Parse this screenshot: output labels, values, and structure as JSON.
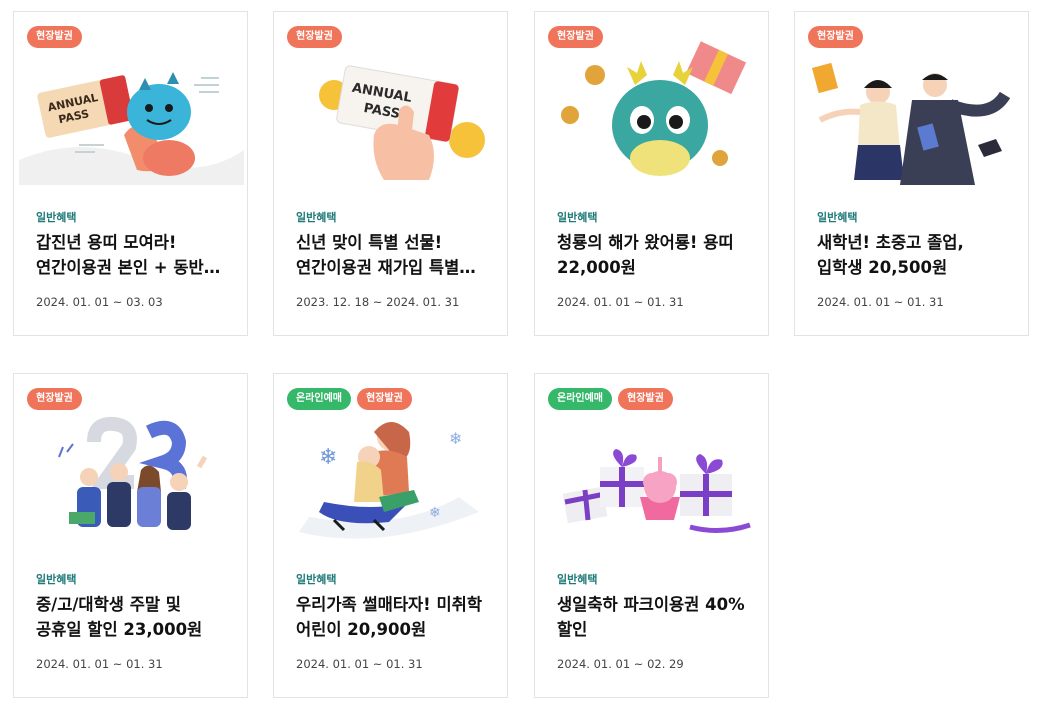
{
  "cards": [
    {
      "badges": [
        "현장발권"
      ],
      "illustration": "annual-pass-dragon",
      "category": "일반혜택",
      "title": "갑진년 용띠 모여라! 연간이용권 본인 + 동반자 할인",
      "date": "2024. 01. 01 ~ 03. 03"
    },
    {
      "badges": [
        "현장발권"
      ],
      "illustration": "annual-pass-ticket-hand",
      "category": "일반혜택",
      "title": "신년 맞이 특별 선물! 연간이용권 재가입 특별 할인",
      "date": "2023. 12. 18 ~ 2024. 01. 31"
    },
    {
      "badges": [
        "현장발권"
      ],
      "illustration": "blue-dragon",
      "category": "일반혜택",
      "title": "청룡의 해가 왔어룡! 용띠 22,000원",
      "date": "2024. 01. 01 ~ 01. 31"
    },
    {
      "badges": [
        "현장발권"
      ],
      "illustration": "students-graduation",
      "category": "일반혜택",
      "title": "새학년! 초중고 졸업, 입학생 20,500원",
      "date": "2024. 01. 01 ~ 01. 31"
    },
    {
      "badges": [
        "현장발권"
      ],
      "illustration": "university-students",
      "category": "일반혜택",
      "title": "중/고/대학생 주말 및 공휴일 할인 23,000원",
      "date": "2024. 01. 01 ~ 01. 31"
    },
    {
      "badges": [
        "온라인예매",
        "현장발권"
      ],
      "illustration": "family-sled",
      "category": "일반혜택",
      "title": "우리가족 썰매타자! 미취학 어린이 20,900원",
      "date": "2024. 01. 01 ~ 01. 31"
    },
    {
      "badges": [
        "온라인예매",
        "현장발권"
      ],
      "illustration": "birthday-gifts",
      "category": "일반혜택",
      "title": "생일축하 파크이용권 40%할인",
      "date": "2024. 01. 01 ~ 02. 29"
    }
  ],
  "ticket_text": "ANNUAL PASS",
  "colors": {
    "badge_site": "#f0745a",
    "badge_online": "#35b86a",
    "category": "#1f7a78"
  }
}
